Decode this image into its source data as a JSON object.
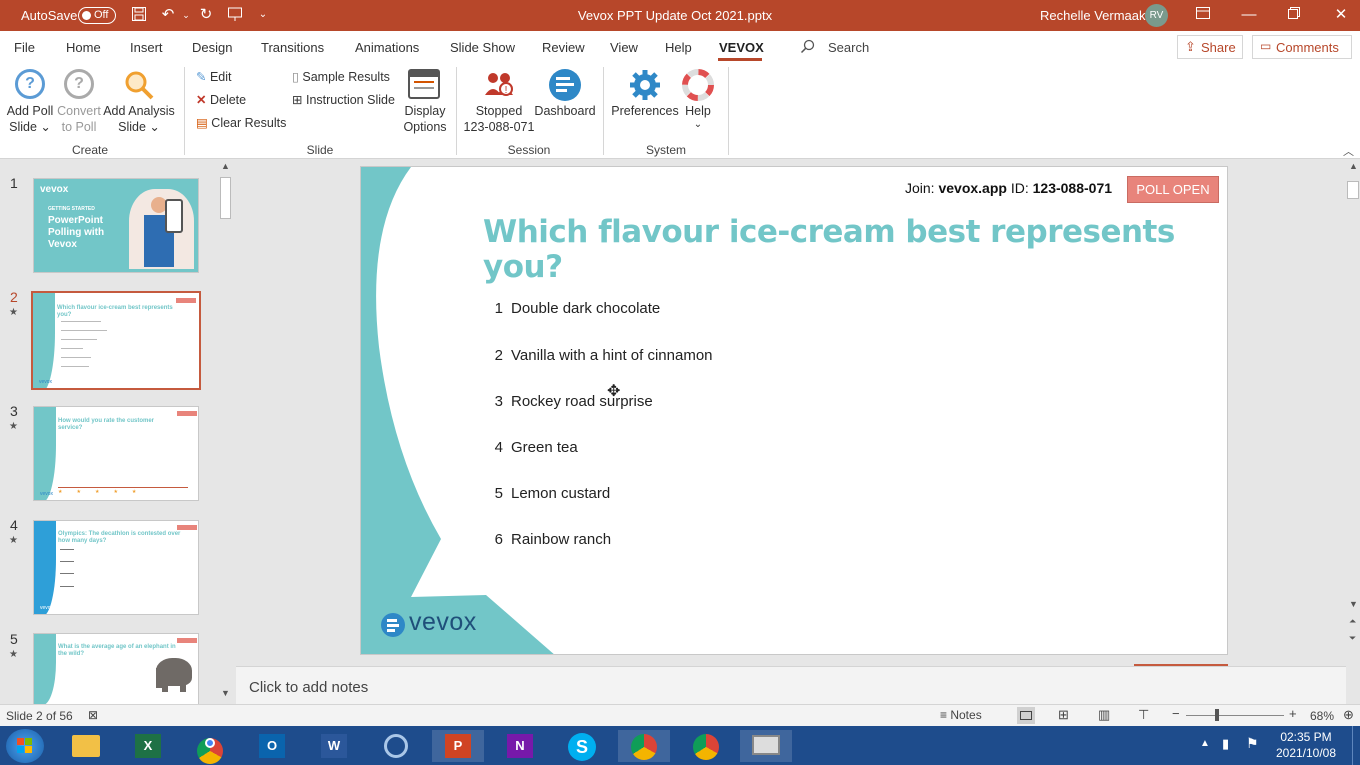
{
  "titlebar": {
    "autosave_label": "AutoSave",
    "autosave_state": "Off",
    "file_title": "Vevox PPT Update Oct 2021.pptx",
    "user_name": "Rechelle Vermaak",
    "user_initials": "RV"
  },
  "tabs": [
    "File",
    "Home",
    "Insert",
    "Design",
    "Transitions",
    "Animations",
    "Slide Show",
    "Review",
    "View",
    "Help",
    "VEVOX"
  ],
  "search_label": "Search",
  "share_label": "Share",
  "comments_label": "Comments",
  "ribbon": {
    "create": {
      "add_poll": [
        "Add Poll",
        "Slide ⌄"
      ],
      "convert": [
        "Convert",
        "to Poll"
      ],
      "add_analysis": [
        "Add Analysis",
        "Slide ⌄"
      ],
      "group": "Create"
    },
    "slide": {
      "edit": "Edit",
      "delete": "Delete",
      "clear": "Clear Results",
      "sample": "Sample Results",
      "instruction": "Instruction Slide",
      "display_options": [
        "Display",
        "Options"
      ],
      "group": "Slide"
    },
    "session": {
      "stopped": [
        "Stopped",
        "123-088-071"
      ],
      "dashboard": "Dashboard",
      "group": "Session"
    },
    "system": {
      "preferences": "Preferences",
      "help": "Help",
      "group": "System"
    }
  },
  "thumbnails": [
    {
      "num": "1",
      "star": "",
      "title": "PowerPoint Polling with Vevox",
      "subtitle": "GETTING STARTED"
    },
    {
      "num": "2",
      "star": "★",
      "title": "Which flavour ice-cream best represents you?",
      "subtitle": ""
    },
    {
      "num": "3",
      "star": "★",
      "title": "How would you rate the customer service?",
      "subtitle": ""
    },
    {
      "num": "4",
      "star": "★",
      "title": "Olympics: The decathlon is contested over how many days?",
      "subtitle": ""
    },
    {
      "num": "5",
      "star": "★",
      "title": "What is the average age of an elephant in the wild?",
      "subtitle": ""
    }
  ],
  "thumb_logo": "vevox",
  "slide": {
    "join_label": "Join:",
    "join_url": "vevox.app",
    "id_label": "ID:",
    "session_id": "123-088-071",
    "poll_status": "POLL OPEN",
    "question": "Which flavour ice-cream best represents you?",
    "options": [
      {
        "n": "1",
        "text": "Double dark chocolate"
      },
      {
        "n": "2",
        "text": "Vanilla with a hint of cinnamon"
      },
      {
        "n": "3",
        "text": "Rockey road surprise"
      },
      {
        "n": "4",
        "text": "Green tea"
      },
      {
        "n": "5",
        "text": "Lemon custard"
      },
      {
        "n": "6",
        "text": "Rainbow ranch"
      }
    ],
    "logo_text": "vevox"
  },
  "notes_placeholder": "Click to add notes",
  "status": {
    "slide_counter": "Slide 2 of 56",
    "notes_label": "Notes",
    "zoom": "68%"
  },
  "clock": {
    "time": "02:35 PM",
    "date": "2021/10/08"
  },
  "colors": {
    "accent": "#b7472a",
    "teal": "#6ec6c8",
    "teal_text": "#72c6c8",
    "poll_open": "#e8847b"
  }
}
